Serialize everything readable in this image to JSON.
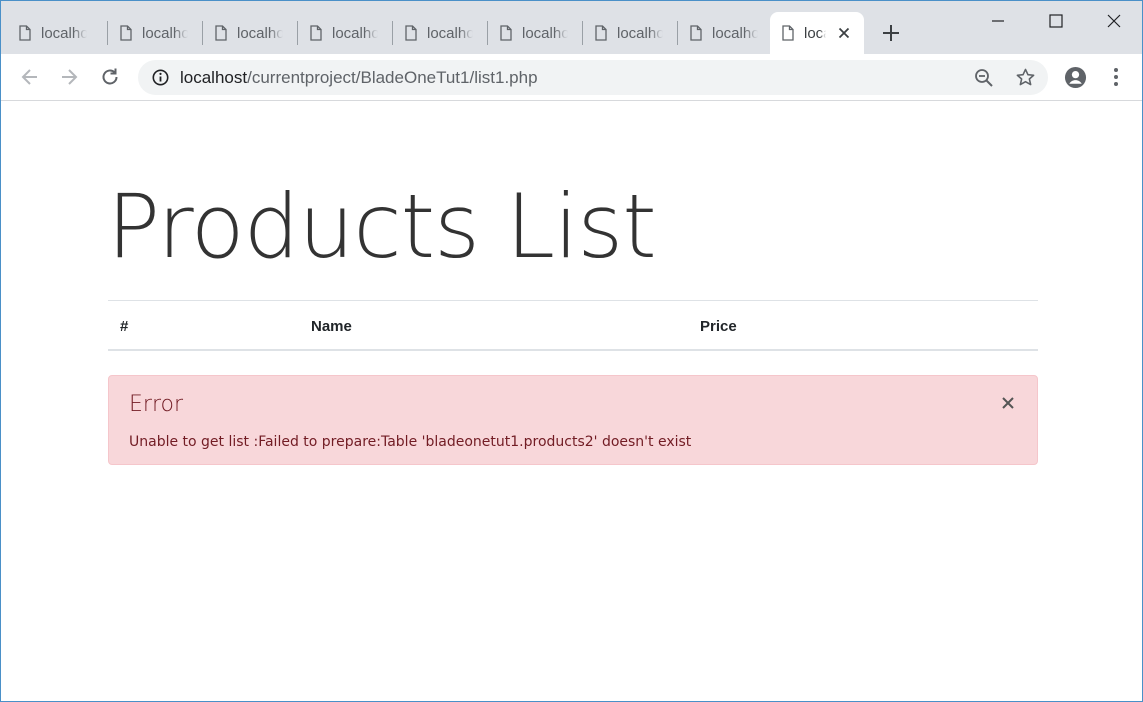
{
  "browser": {
    "tabs": [
      {
        "title": "localhost",
        "active": false
      },
      {
        "title": "localhost",
        "active": false
      },
      {
        "title": "localhost",
        "active": false
      },
      {
        "title": "localhost",
        "active": false
      },
      {
        "title": "localhost",
        "active": false
      },
      {
        "title": "localhost",
        "active": false
      },
      {
        "title": "localhost",
        "active": false
      },
      {
        "title": "localhost",
        "active": false
      },
      {
        "title": "localhost",
        "active": true
      }
    ],
    "address": {
      "host": "localhost",
      "path": "/currentproject/BladeOneTut1/list1.php"
    },
    "icons": {
      "tab": "file-icon",
      "close": "close-icon",
      "new_tab": "plus-icon",
      "back": "arrow-left-icon",
      "forward": "arrow-right-icon",
      "reload": "reload-icon",
      "info": "info-icon",
      "zoom": "zoom-out-icon",
      "bookmark": "star-icon",
      "profile": "account-icon",
      "menu": "more-vertical-icon"
    }
  },
  "page": {
    "title": "Products List",
    "table": {
      "columns": [
        "#",
        "Name",
        "Price"
      ],
      "rows": []
    },
    "alert": {
      "title": "Error",
      "message": "Unable to get list :Failed to prepare:Table 'bladeonetut1.products2' doesn't exist",
      "close_icon": "close-icon"
    }
  },
  "colors": {
    "tabstrip": "#dee1e6",
    "alert_bg": "#f8d7da",
    "alert_text": "#721c24",
    "heading": "#333333"
  }
}
